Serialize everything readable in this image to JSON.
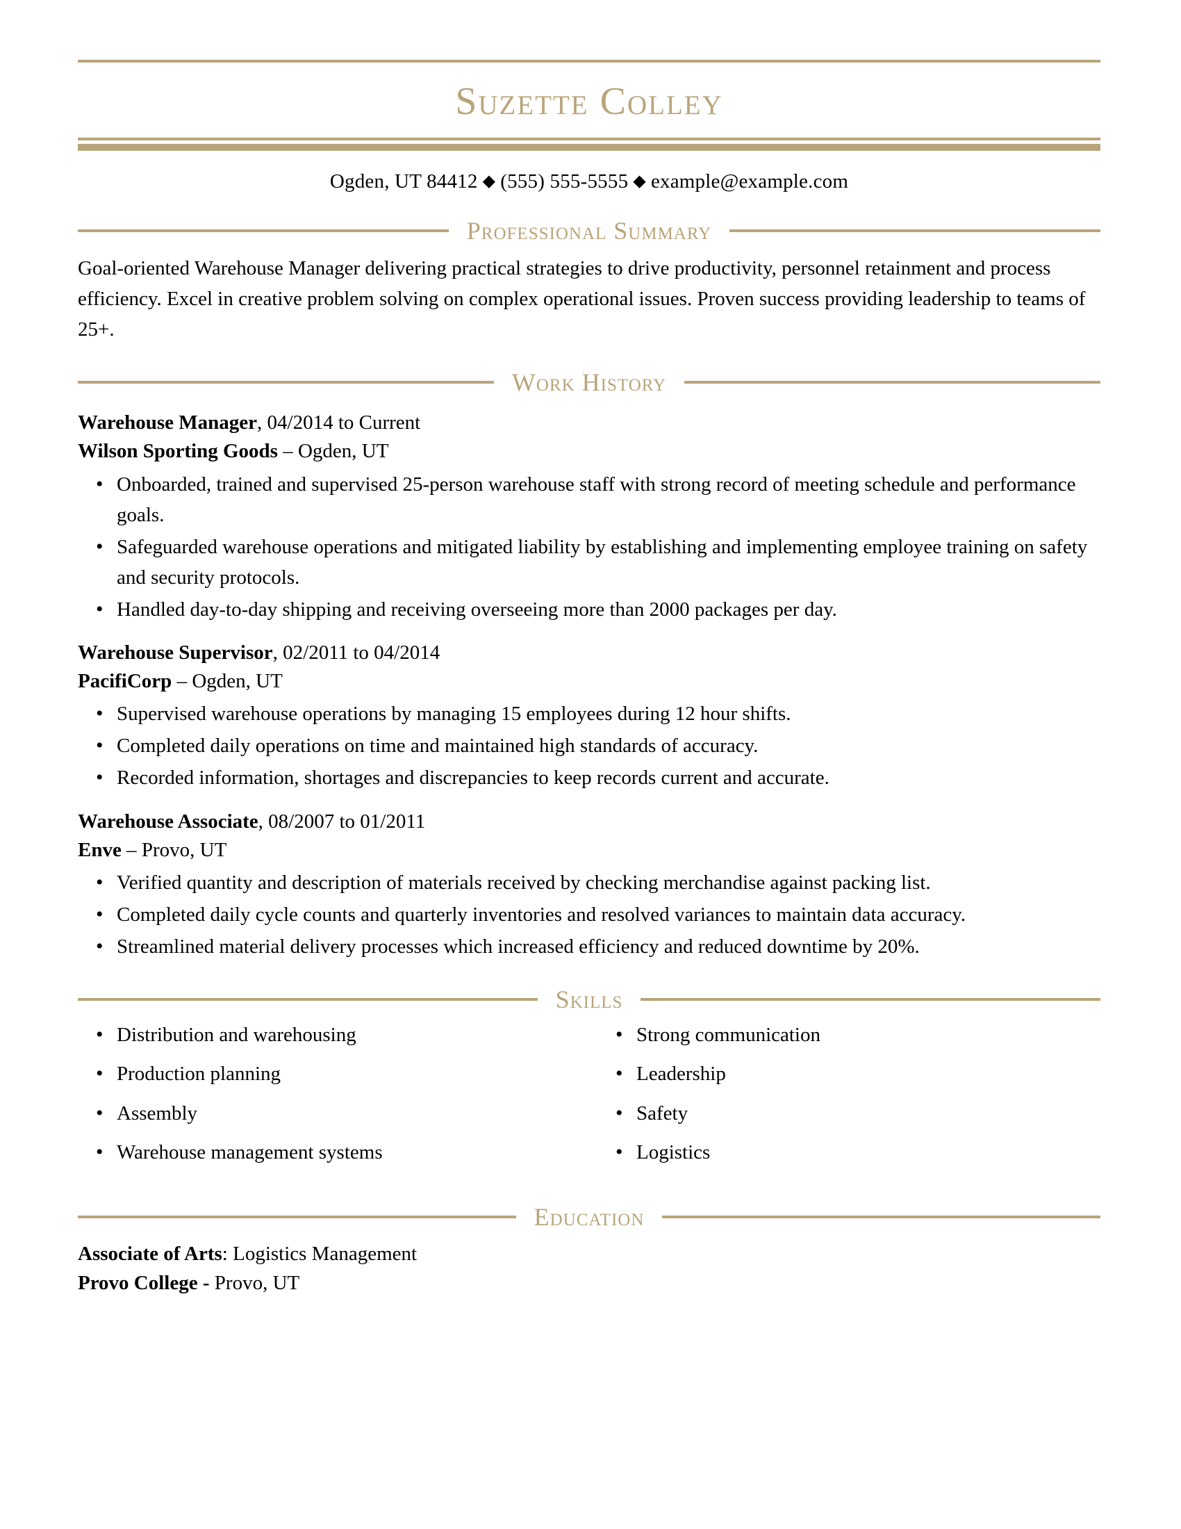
{
  "header": {
    "name": "Suzette Colley",
    "contact": {
      "location": "Ogden, UT 84412",
      "separator": "◆",
      "phone": "(555) 555-5555",
      "email": "example@example.com"
    }
  },
  "theme": {
    "accent": "#b9a47a",
    "text": "#000000",
    "background": "#ffffff"
  },
  "sections": {
    "summary": {
      "heading": "Professional Summary",
      "text": "Goal-oriented Warehouse Manager delivering practical strategies to drive productivity, personnel retainment and process efficiency. Excel in creative problem solving on complex operational issues. Proven success providing leadership to teams of 25+."
    },
    "work_history": {
      "heading": "Work History",
      "jobs": [
        {
          "title": "Warehouse Manager",
          "dates": ", 04/2014 to Current",
          "company": "Wilson Sporting Goods",
          "location": " – Ogden, UT",
          "bullets": [
            "Onboarded, trained and supervised 25-person warehouse staff with strong record of meeting schedule and performance goals.",
            "Safeguarded warehouse operations and mitigated liability by establishing and implementing employee training on safety and security protocols.",
            "Handled day-to-day shipping and receiving overseeing more than 2000 packages per day."
          ]
        },
        {
          "title": "Warehouse Supervisor",
          "dates": ", 02/2011 to 04/2014",
          "company": "PacifiCorp",
          "location": " – Ogden, UT",
          "bullets": [
            "Supervised warehouse operations by managing 15 employees during 12 hour shifts.",
            "Completed daily operations on time and maintained high standards of accuracy.",
            "Recorded information, shortages and discrepancies to keep records current and accurate."
          ]
        },
        {
          "title": "Warehouse Associate",
          "dates": ", 08/2007 to 01/2011",
          "company": "Enve",
          "location": " – Provo, UT",
          "bullets": [
            "Verified quantity and description of materials received by checking merchandise against packing list.",
            "Completed daily cycle counts and quarterly inventories and resolved variances to maintain data accuracy.",
            "Streamlined material delivery processes which increased efficiency and reduced downtime by 20%."
          ]
        }
      ]
    },
    "skills": {
      "heading": "Skills",
      "column_left": [
        "Distribution and warehousing",
        "Production planning",
        "Assembly",
        "Warehouse management systems"
      ],
      "column_right": [
        "Strong communication",
        "Leadership",
        "Safety",
        "Logistics"
      ]
    },
    "education": {
      "heading": "Education",
      "degree": "Associate of Arts",
      "degree_detail": ": Logistics Management",
      "school": "Provo College -",
      "school_detail": " Provo, UT"
    }
  }
}
